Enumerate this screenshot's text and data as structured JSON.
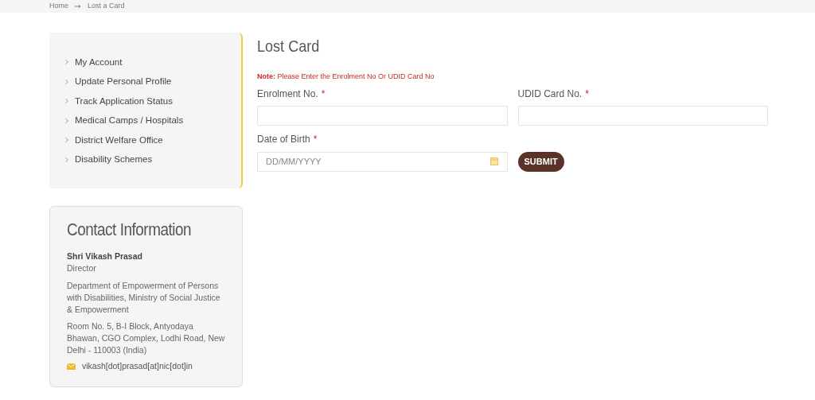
{
  "breadcrumb": [
    "Home",
    "Lost a Card"
  ],
  "sidebar": {
    "items": [
      {
        "label": "My Account"
      },
      {
        "label": "Update Personal Profile"
      },
      {
        "label": "Track Application Status"
      },
      {
        "label": "Medical Camps / Hospitals"
      },
      {
        "label": "District Welfare Office"
      },
      {
        "label": "Disability Schemes"
      }
    ]
  },
  "contact": {
    "title": "Contact Information",
    "name": "Shri Vikash Prasad",
    "role": "Director",
    "department": "Department of Empowerment of Persons with Disabilities, Ministry of Social Justice & Empowerment",
    "address": "Room No. 5, B-I Block, Antyodaya Bhawan, CGO Complex, Lodhi Road, New Delhi - 110003 (India)",
    "email": "vikash[dot]prasad[at]nic[dot]in"
  },
  "form": {
    "title": "Lost Card",
    "note": "**Note:** Please Enter the Enrolment No Or UDID Card No",
    "fields": [
      {
        "label": "Enrolment No.",
        "required": "*",
        "kind": "text"
      },
      {
        "label": "UDID Card No.",
        "required": "*",
        "kind": "text"
      },
      {
        "label": "Date of Birth",
        "required": "*",
        "kind": "date",
        "placeholder": "DD/MM/YYYY"
      }
    ],
    "submit": "SUBMIT"
  }
}
